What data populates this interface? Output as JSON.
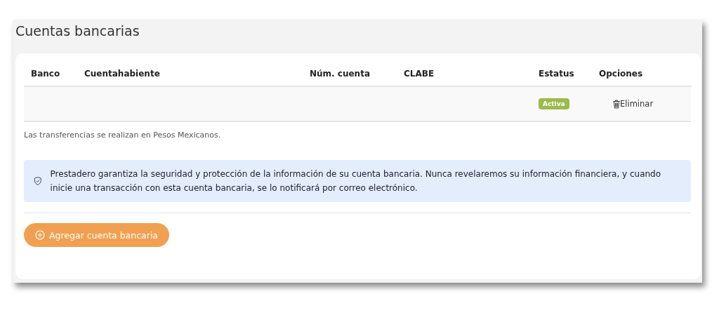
{
  "title": "Cuentas bancarias",
  "table": {
    "columns": [
      "Banco",
      "Cuentahabiente",
      "Núm. cuenta",
      "CLABE",
      "Estatus",
      "Opciones"
    ],
    "rows": [
      {
        "status": "Activa",
        "action": "Eliminar"
      }
    ]
  },
  "note": "Las transferencias se realizan en Pesos Mexicanos.",
  "info": "Prestadero garantiza la seguridad y protección de la información de su cuenta bancaria. Nunca revelaremos su información financiera, y cuando inicie una transacción con esta cuenta bancaria, se lo notificará por correo electrónico.",
  "add_button": "Agregar cuenta bancaria"
}
